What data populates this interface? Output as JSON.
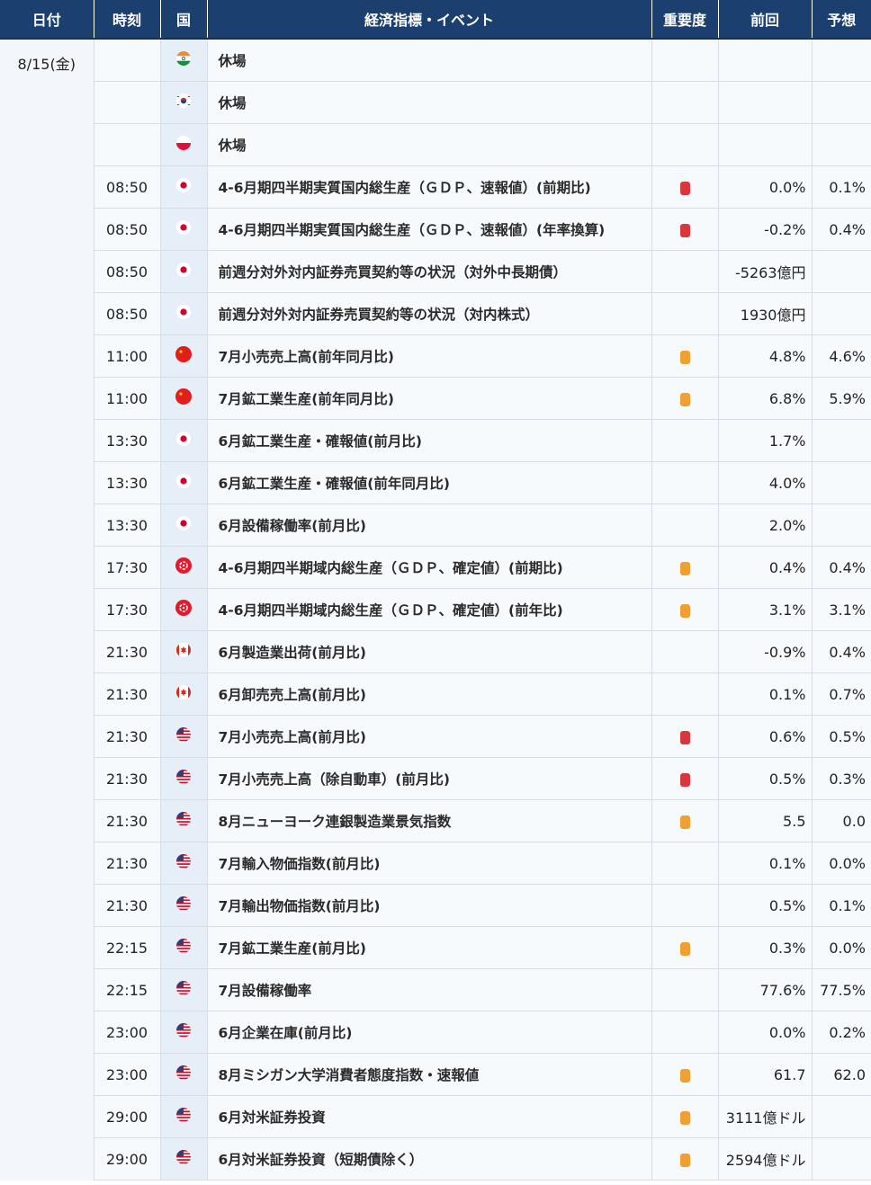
{
  "header": {
    "date": "日付",
    "time": "時刻",
    "country": "国",
    "event": "経済指標・イベント",
    "importance": "重要度",
    "previous": "前回",
    "forecast": "予想"
  },
  "colors": {
    "header_bg": "#1b3f6e",
    "importance_high": "#d9363e",
    "importance_mid": "#f0a030"
  },
  "date_label": "8/15(金)",
  "rows": [
    {
      "time": "",
      "flag": "india-flag-icon",
      "event": "休場",
      "importance": "",
      "previous": "",
      "forecast": ""
    },
    {
      "time": "",
      "flag": "korea-flag-icon",
      "event": "休場",
      "importance": "",
      "previous": "",
      "forecast": ""
    },
    {
      "time": "",
      "flag": "poland-flag-icon",
      "event": "休場",
      "importance": "",
      "previous": "",
      "forecast": ""
    },
    {
      "time": "08:50",
      "flag": "japan-flag-icon",
      "event": "4-6月期四半期実質国内総生産（ＧＤＰ、速報値）(前期比)",
      "importance": "high",
      "previous": "0.0%",
      "forecast": "0.1%"
    },
    {
      "time": "08:50",
      "flag": "japan-flag-icon",
      "event": "4-6月期四半期実質国内総生産（ＧＤＰ、速報値）(年率換算)",
      "importance": "high",
      "previous": "-0.2%",
      "forecast": "0.4%"
    },
    {
      "time": "08:50",
      "flag": "japan-flag-icon",
      "event": "前週分対外対内証券売買契約等の状況（対外中長期債）",
      "importance": "",
      "previous": "-5263億円",
      "forecast": ""
    },
    {
      "time": "08:50",
      "flag": "japan-flag-icon",
      "event": "前週分対外対内証券売買契約等の状況（対内株式）",
      "importance": "",
      "previous": "1930億円",
      "forecast": ""
    },
    {
      "time": "11:00",
      "flag": "china-flag-icon",
      "event": "7月小売売上高(前年同月比)",
      "importance": "mid",
      "previous": "4.8%",
      "forecast": "4.6%"
    },
    {
      "time": "11:00",
      "flag": "china-flag-icon",
      "event": "7月鉱工業生産(前年同月比)",
      "importance": "mid",
      "previous": "6.8%",
      "forecast": "5.9%"
    },
    {
      "time": "13:30",
      "flag": "japan-flag-icon",
      "event": "6月鉱工業生産・確報値(前月比)",
      "importance": "",
      "previous": "1.7%",
      "forecast": ""
    },
    {
      "time": "13:30",
      "flag": "japan-flag-icon",
      "event": "6月鉱工業生産・確報値(前年同月比)",
      "importance": "",
      "previous": "4.0%",
      "forecast": ""
    },
    {
      "time": "13:30",
      "flag": "japan-flag-icon",
      "event": "6月設備稼働率(前月比)",
      "importance": "",
      "previous": "2.0%",
      "forecast": ""
    },
    {
      "time": "17:30",
      "flag": "hongkong-flag-icon",
      "event": "4-6月期四半期域内総生産（ＧＤＰ、確定値）(前期比)",
      "importance": "mid",
      "previous": "0.4%",
      "forecast": "0.4%"
    },
    {
      "time": "17:30",
      "flag": "hongkong-flag-icon",
      "event": "4-6月期四半期域内総生産（ＧＤＰ、確定値）(前年比)",
      "importance": "mid",
      "previous": "3.1%",
      "forecast": "3.1%"
    },
    {
      "time": "21:30",
      "flag": "canada-flag-icon",
      "event": "6月製造業出荷(前月比)",
      "importance": "",
      "previous": "-0.9%",
      "forecast": "0.4%"
    },
    {
      "time": "21:30",
      "flag": "canada-flag-icon",
      "event": "6月卸売売上高(前月比)",
      "importance": "",
      "previous": "0.1%",
      "forecast": "0.7%"
    },
    {
      "time": "21:30",
      "flag": "usa-flag-icon",
      "event": "7月小売売上高(前月比)",
      "importance": "high",
      "previous": "0.6%",
      "forecast": "0.5%"
    },
    {
      "time": "21:30",
      "flag": "usa-flag-icon",
      "event": "7月小売売上高（除自動車）(前月比)",
      "importance": "high",
      "previous": "0.5%",
      "forecast": "0.3%"
    },
    {
      "time": "21:30",
      "flag": "usa-flag-icon",
      "event": "8月ニューヨーク連銀製造業景気指数",
      "importance": "mid",
      "previous": "5.5",
      "forecast": "0.0"
    },
    {
      "time": "21:30",
      "flag": "usa-flag-icon",
      "event": "7月輸入物価指数(前月比)",
      "importance": "",
      "previous": "0.1%",
      "forecast": "0.0%"
    },
    {
      "time": "21:30",
      "flag": "usa-flag-icon",
      "event": "7月輸出物価指数(前月比)",
      "importance": "",
      "previous": "0.5%",
      "forecast": "0.1%"
    },
    {
      "time": "22:15",
      "flag": "usa-flag-icon",
      "event": "7月鉱工業生産(前月比)",
      "importance": "mid",
      "previous": "0.3%",
      "forecast": "0.0%"
    },
    {
      "time": "22:15",
      "flag": "usa-flag-icon",
      "event": "7月設備稼働率",
      "importance": "",
      "previous": "77.6%",
      "forecast": "77.5%"
    },
    {
      "time": "23:00",
      "flag": "usa-flag-icon",
      "event": "6月企業在庫(前月比)",
      "importance": "",
      "previous": "0.0%",
      "forecast": "0.2%"
    },
    {
      "time": "23:00",
      "flag": "usa-flag-icon",
      "event": "8月ミシガン大学消費者態度指数・速報値",
      "importance": "mid",
      "previous": "61.7",
      "forecast": "62.0"
    },
    {
      "time": "29:00",
      "flag": "usa-flag-icon",
      "event": "6月対米証券投資",
      "importance": "mid",
      "previous": "3111億ドル",
      "forecast": ""
    },
    {
      "time": "29:00",
      "flag": "usa-flag-icon",
      "event": "6月対米証券投資（短期債除く）",
      "importance": "mid",
      "previous": "2594億ドル",
      "forecast": ""
    }
  ]
}
